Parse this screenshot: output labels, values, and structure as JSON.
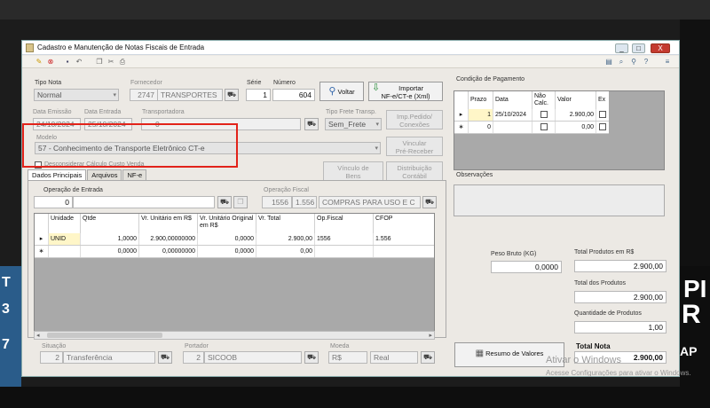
{
  "background": {
    "deco_1": "PI",
    "deco_2": "R",
    "deco_3": "AP",
    "left_deco": [
      "T",
      "3",
      "7"
    ]
  },
  "window": {
    "title": "Cadastro e Manutenção de Notas Fiscais de Entrada",
    "buttons": [
      "_",
      "□",
      "X"
    ]
  },
  "header": {
    "tipo_nota_label": "Tipo Nota",
    "tipo_nota_value": "Normal",
    "fornecedor_label": "Fornecedor",
    "fornecedor_code": "2747",
    "fornecedor_name": "TRANSPORTES",
    "serie_label": "Série",
    "serie_value": "1",
    "numero_label": "Número",
    "numero_value": "604",
    "voltar_label": "Voltar",
    "importar_label_1": "Importar",
    "importar_label_2": "NF-e/CT-e (Xml)",
    "data_emissao_label": "Data Emissão",
    "data_emissao_value": "24/10/2024",
    "data_entrada_label": "Data Entrada",
    "data_entrada_value": "25/10/2024",
    "transportadora_label": "Transportadora",
    "transportadora_value": "0",
    "tipo_frete_label": "Tipo Frete Transp.",
    "tipo_frete_value": "Sem_Frete",
    "imp_pedido_label_1": "Imp.Pedido/",
    "imp_pedido_label_2": "Conexões",
    "modelo_label": "Modelo",
    "modelo_value": "57 - Conhecimento de Transporte Eletrônico CT-e",
    "vincular_label_1": "Vincular",
    "vincular_label_2": "Pré-Receber",
    "desconsiderar_label": "Desconsiderar Cálculo Custo Venda",
    "vinculo_bens_label_1": "Vínculo de",
    "vinculo_bens_label_2": "Bens",
    "distribuicao_label_1": "Distribuição",
    "distribuicao_label_2": "Contábil"
  },
  "tabs": [
    "Dados Principais",
    "Arquivos",
    "NF-e"
  ],
  "dados": {
    "operacao_entrada_label": "Operação de Entrada",
    "operacao_entrada_value": "0",
    "operacao_fiscal_label": "Operação Fiscal",
    "operacao_fiscal_code": "1556",
    "operacao_fiscal_cfop": "1.556",
    "operacao_fiscal_desc": "COMPRAS PARA USO E C"
  },
  "items_grid": {
    "columns": [
      "Unidade",
      "Qtde",
      "Vr. Unitário em R$",
      "Vr. Unitário Original em R$",
      "Vr. Total",
      "Op.Fiscal",
      "CFOP"
    ],
    "rows": [
      {
        "marker": "▸",
        "unidade": "UNID",
        "qtde": "1,0000",
        "vr_unit": "2.900,00000000",
        "vr_orig": "0,0000",
        "vr_total": "2.900,00",
        "op_fiscal": "1556",
        "cfop": "1.556"
      },
      {
        "marker": "∗",
        "unidade": "",
        "qtde": "0,0000",
        "vr_unit": "0,00000000",
        "vr_orig": "0,0000",
        "vr_total": "0,00",
        "op_fiscal": "",
        "cfop": ""
      }
    ]
  },
  "footer": {
    "situacao_label": "Situação",
    "situacao_code": "2",
    "situacao_value": "Transferência",
    "portador_label": "Portador",
    "portador_code": "2",
    "portador_value": "SICOOB",
    "moeda_label": "Moeda",
    "moeda_code": "R$",
    "moeda_value": "Real"
  },
  "pagamento": {
    "title": "Condição de Pagamento",
    "columns": [
      "Prazo",
      "Data",
      "Não Calc.",
      "Valor",
      "Ex"
    ],
    "rows": [
      {
        "marker": "▸",
        "prazo": "1",
        "data": "25/10/2024",
        "valor": "2.900,00"
      },
      {
        "marker": "∗",
        "prazo": "0",
        "data": "",
        "valor": "0,00"
      }
    ]
  },
  "observacoes_label": "Observações",
  "totais": {
    "peso_bruto_label": "Peso Bruto (KG)",
    "peso_bruto_value": "0,0000",
    "total_produtos_rs_label": "Total Produtos em R$",
    "total_produtos_rs_value": "2.900,00",
    "total_produtos_label": "Total dos Produtos",
    "total_produtos_value": "2.900,00",
    "quantidade_label": "Quantidade de Produtos",
    "quantidade_value": "1,00",
    "total_nota_label": "Total Nota",
    "total_nota_value": "2.900,00",
    "resumo_label": "Resumo de Valores"
  },
  "watermark": {
    "line1": "Ativar o Windows",
    "line2": "Acesse Configurações para ativar o Windows."
  }
}
